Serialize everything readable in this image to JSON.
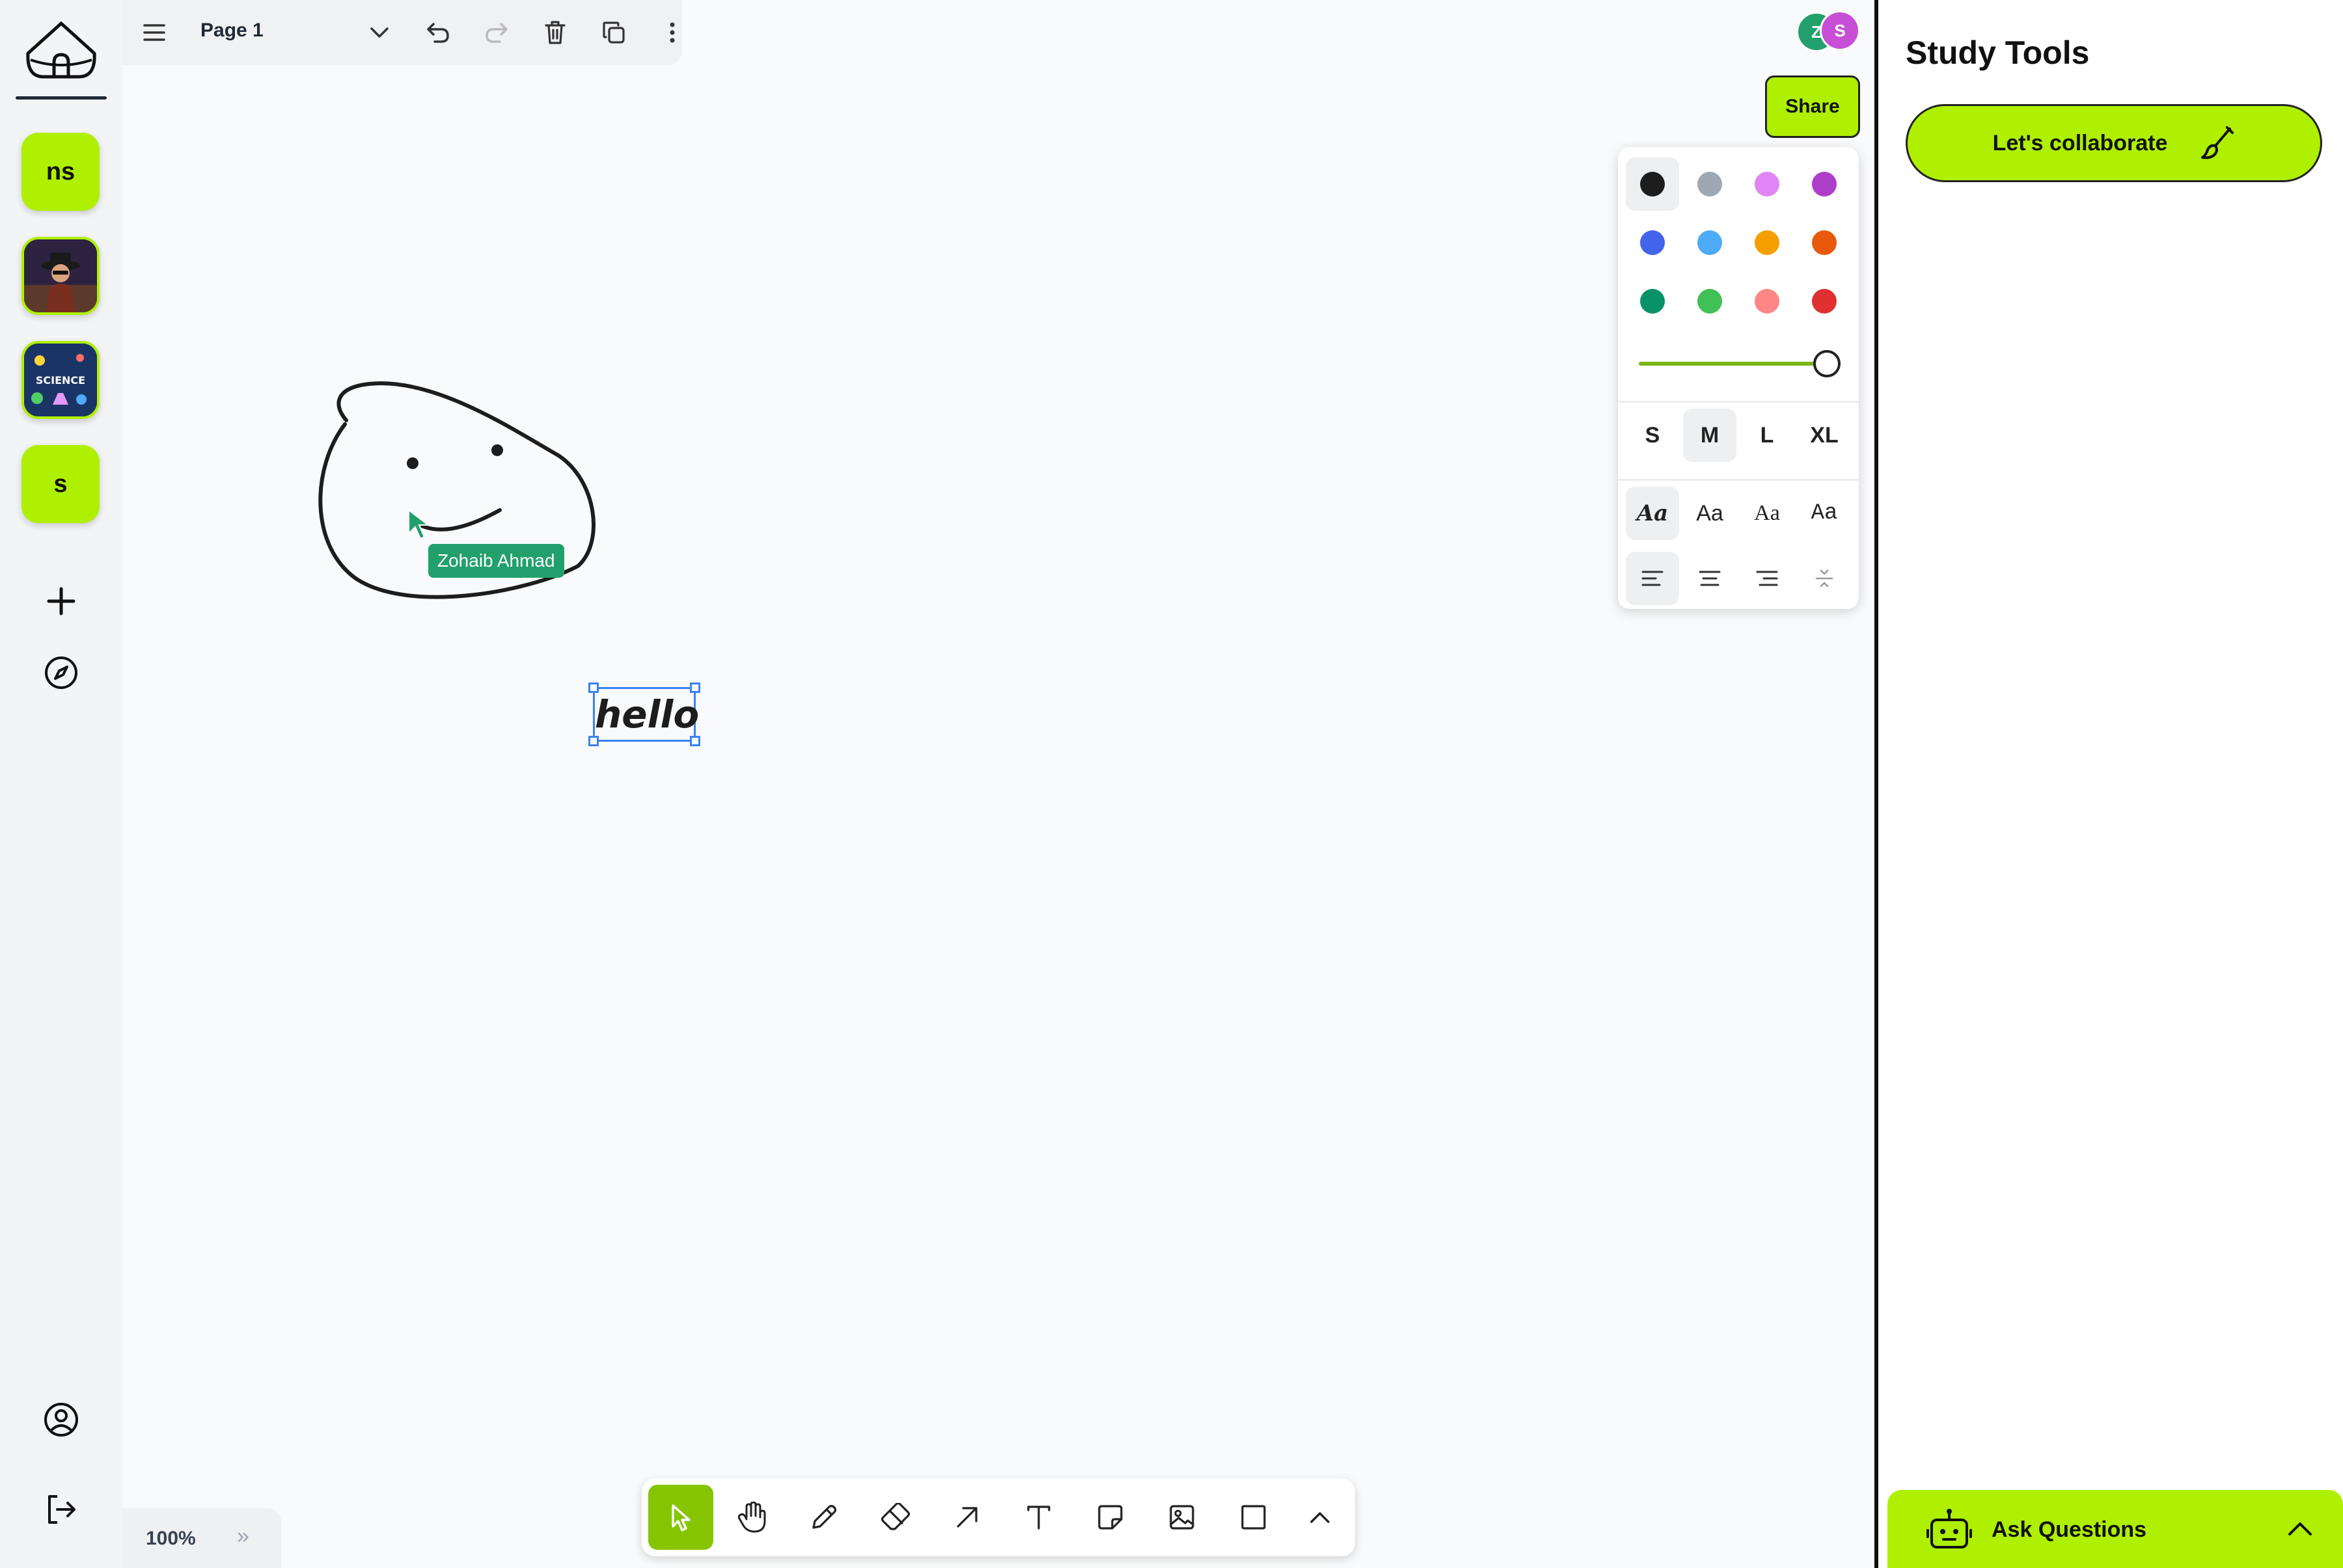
{
  "topbar": {
    "page_name": "Page 1"
  },
  "rail": {
    "servers": [
      {
        "label": "ns"
      },
      {
        "label": ""
      },
      {
        "label": ""
      },
      {
        "label": "s"
      }
    ],
    "science_label": "SCIENCE"
  },
  "canvas": {
    "cursor_label": "Zohaib Ahmad",
    "text_shape": "hello"
  },
  "header": {
    "share_label": "Share",
    "avatars": [
      {
        "initial": "Z",
        "color": "#22a06b"
      },
      {
        "initial": "S",
        "color": "#c64fd6"
      }
    ]
  },
  "style_panel": {
    "colors": [
      "#1d1d1d",
      "#9fa8b2",
      "#e085f4",
      "#ae3ec9",
      "#4263eb",
      "#4dabf7",
      "#f59f00",
      "#e8590c",
      "#099268",
      "#40c057",
      "#ff8787",
      "#e03131"
    ],
    "selected_color": "#1d1d1d",
    "opacity": 1.0,
    "sizes": [
      "S",
      "M",
      "L",
      "XL"
    ],
    "selected_size": "M",
    "fonts": [
      "Aa",
      "Aa",
      "Aa",
      "Aa"
    ],
    "selected_font": 0,
    "selected_align": "left"
  },
  "right_panel": {
    "title": "Study Tools",
    "collab_label": "Let's collaborate",
    "ask_label": "Ask Questions"
  },
  "bottom": {
    "zoom": "100%",
    "more": "»",
    "selected_tool": "select"
  },
  "colors": {
    "accent": "#aef000",
    "accent_dark": "#86c400"
  }
}
